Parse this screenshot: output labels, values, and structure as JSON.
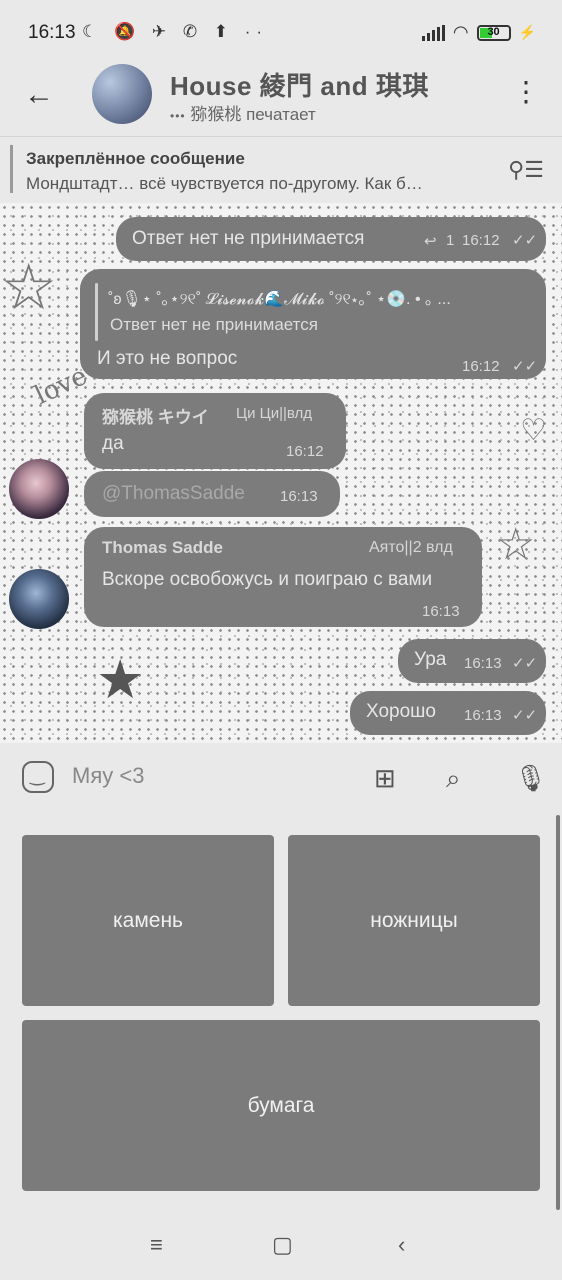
{
  "status_bar": {
    "time": "16:13",
    "left_icons": [
      "moon-icon",
      "bell-off-icon",
      "telegram-icon",
      "whatsapp-icon",
      "upload-icon",
      "more-icon"
    ],
    "battery_level": "30"
  },
  "header": {
    "title": "House 綾門 and 琪琪",
    "subtitle": "猕猴桃 печатает",
    "typing_dots": "•••"
  },
  "pinned": {
    "title": "Закреплённое сообщение",
    "text": "Мондштадт… всё чувствуется по-другому. Как б…"
  },
  "messages": [
    {
      "text": "Ответ нет не принимается",
      "reply_count": "1",
      "time": "16:12"
    },
    {
      "quote_author": "˚ʚ🎙⋆ ˚｡⋆୨୧˚ 𝓛𝓲𝓼𝓮𝓷𝓸𝓴🌊𝓜𝓲𝓴𝓸 ˚୨୧⋆｡˚ ⋆💿. • ｡ ...",
      "quote_text": "Ответ нет не принимается",
      "text": "И это не вопрос",
      "time": "16:12"
    },
    {
      "author": "猕猴桃 キウイ",
      "badge": "Ци Ци||влд",
      "text": "да",
      "time": "16:12"
    },
    {
      "text": "@ThomasSadde",
      "time": "16:13"
    },
    {
      "author": "Thomas Sadde",
      "badge": "Аято||2 влд",
      "text": "Вскоре освобожусь и поиграю с вами",
      "time": "16:13"
    },
    {
      "text": "Ура",
      "time": "16:13"
    },
    {
      "text": "Хорошо",
      "time": "16:13"
    }
  ],
  "composer": {
    "placeholder": "Мяу <3"
  },
  "keyboard": {
    "buttons": [
      "камень",
      "ножницы",
      "бумага"
    ]
  }
}
